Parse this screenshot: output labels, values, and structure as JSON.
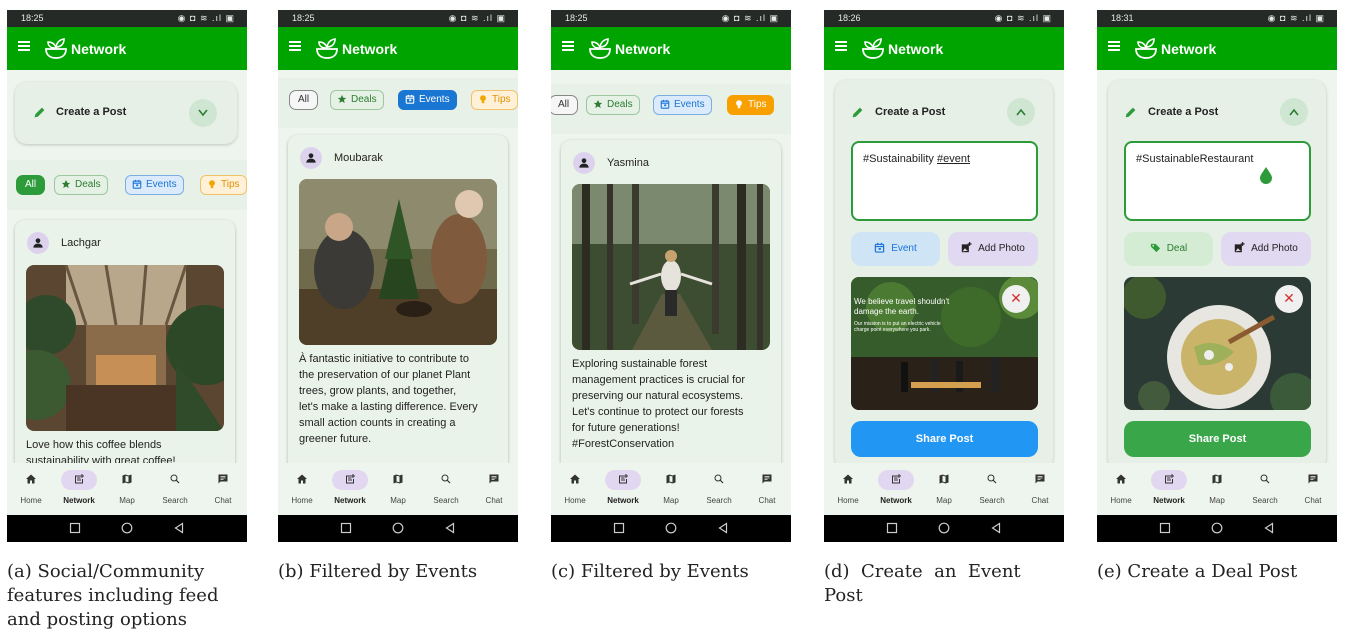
{
  "colors": {
    "appbar": "#00a400",
    "events_blue": "#1976d2",
    "tips_orange": "#f7a000",
    "share_blue": "#2196f3",
    "share_green": "#3aa64a"
  },
  "app": {
    "title": "Network"
  },
  "nav": [
    {
      "label": "Home",
      "icon": "home-icon"
    },
    {
      "label": "Network",
      "icon": "network-post-icon"
    },
    {
      "label": "Map",
      "icon": "map-icon"
    },
    {
      "label": "Search",
      "icon": "search-icon"
    },
    {
      "label": "Chat",
      "icon": "chat-icon"
    }
  ],
  "chips": {
    "all": "All",
    "deals": "Deals",
    "events": "Events",
    "tips": "Tips"
  },
  "screens": [
    {
      "time": "18:25",
      "caption": [
        "(a) Social/Community",
        "features including feed",
        "and posting options"
      ],
      "create_label": "Create a Post",
      "active_chip": "All",
      "post": {
        "user": "Lachgar",
        "text": [
          "Love how this coffee blends",
          "sustainability with great coffee!"
        ]
      }
    },
    {
      "time": "18:25",
      "caption": [
        "(b) Filtered by Events"
      ],
      "active_chip": "Events",
      "post": {
        "user": "Moubarak",
        "text": [
          "À fantastic initiative to contribute to",
          "the preservation of our planet Plant",
          "trees, grow plants, and together,",
          "let's make a lasting difference. Every",
          "small action counts in creating a",
          "greener future."
        ]
      }
    },
    {
      "time": "18:25",
      "caption": [
        "(c) Filtered by Events"
      ],
      "active_chip": "Tips",
      "post": {
        "user": "Yasmina",
        "text": [
          "Exploring sustainable forest",
          "management practices is crucial for",
          "preserving our natural ecosystems.",
          "Let's continue to protect our forests",
          "for future generations!",
          "#ForestConservation"
        ]
      }
    },
    {
      "time": "18:26",
      "caption": [
        "(d)  Create  an  Event",
        "Post"
      ],
      "create_label": "Create a Post",
      "input_text": "#Sustainability",
      "input_tag": "#event",
      "type_button": "Event",
      "photo_button": "Add Photo",
      "overlay_text": [
        "We believe travel shouldn't",
        "damage the earth."
      ],
      "overlay_small": [
        "Our mission is to put an electric vehicle",
        "charge point everywhere you park."
      ],
      "share": "Share Post"
    },
    {
      "time": "18:31",
      "caption": [
        "(e) Create a Deal Post"
      ],
      "create_label": "Create a Post",
      "input_text": "#SustainableRestaurant",
      "type_button": "Deal",
      "photo_button": "Add Photo",
      "share": "Share Post"
    }
  ]
}
